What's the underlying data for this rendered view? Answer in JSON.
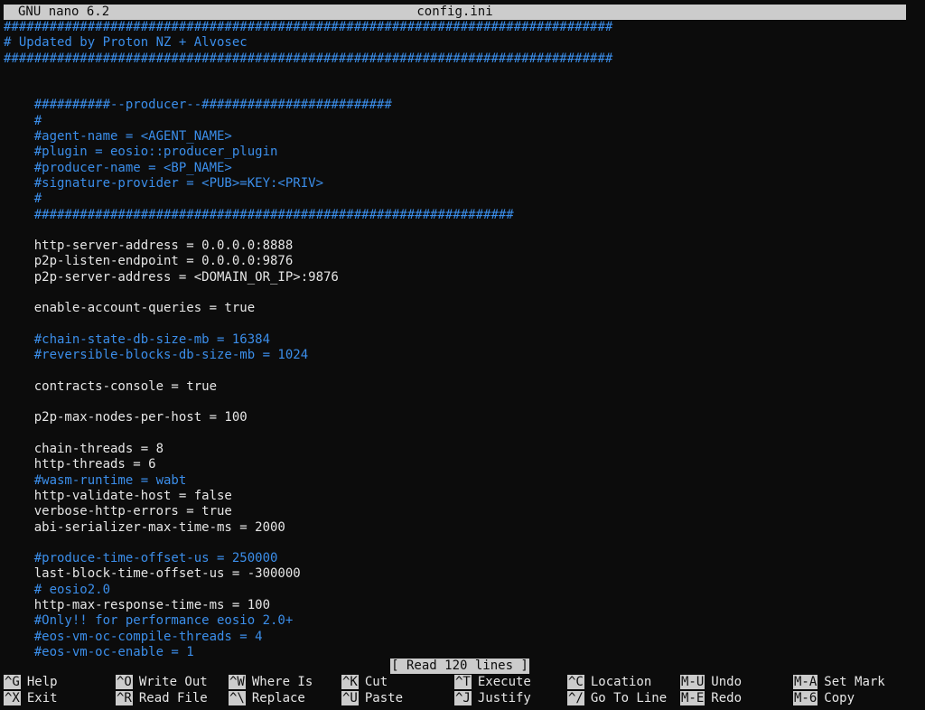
{
  "titlebar": {
    "app": "GNU nano 6.2",
    "filename": "config.ini"
  },
  "colors": {
    "comment": "#3b8eea",
    "text": "#e6e6e6",
    "background": "#0c0c0c",
    "bar": "#cccccc"
  },
  "lines": [
    {
      "text": "################################################################################",
      "type": "comment"
    },
    {
      "text": "# Updated by Proton NZ + Alvosec",
      "type": "comment"
    },
    {
      "text": "################################################################################",
      "type": "comment"
    },
    {
      "text": "",
      "type": "text"
    },
    {
      "text": "",
      "type": "text"
    },
    {
      "text": "    ##########--producer--#########################",
      "type": "comment"
    },
    {
      "text": "    #",
      "type": "comment"
    },
    {
      "text": "    #agent-name = <AGENT_NAME>",
      "type": "comment"
    },
    {
      "text": "    #plugin = eosio::producer_plugin",
      "type": "comment"
    },
    {
      "text": "    #producer-name = <BP_NAME>",
      "type": "comment"
    },
    {
      "text": "    #signature-provider = <PUB>=KEY:<PRIV>",
      "type": "comment"
    },
    {
      "text": "    #",
      "type": "comment"
    },
    {
      "text": "    ###############################################################",
      "type": "comment"
    },
    {
      "text": "",
      "type": "text"
    },
    {
      "text": "    http-server-address = 0.0.0.0:8888",
      "type": "text"
    },
    {
      "text": "    p2p-listen-endpoint = 0.0.0.0:9876",
      "type": "text"
    },
    {
      "text": "    p2p-server-address = <DOMAIN_OR_IP>:9876",
      "type": "text"
    },
    {
      "text": "",
      "type": "text"
    },
    {
      "text": "    enable-account-queries = true",
      "type": "text"
    },
    {
      "text": "",
      "type": "text"
    },
    {
      "text": "    #chain-state-db-size-mb = 16384",
      "type": "comment"
    },
    {
      "text": "    #reversible-blocks-db-size-mb = 1024",
      "type": "comment"
    },
    {
      "text": "",
      "type": "text"
    },
    {
      "text": "    contracts-console = true",
      "type": "text"
    },
    {
      "text": "",
      "type": "text"
    },
    {
      "text": "    p2p-max-nodes-per-host = 100",
      "type": "text"
    },
    {
      "text": "",
      "type": "text"
    },
    {
      "text": "    chain-threads = 8",
      "type": "text"
    },
    {
      "text": "    http-threads = 6",
      "type": "text"
    },
    {
      "text": "    #wasm-runtime = wabt",
      "type": "comment"
    },
    {
      "text": "    http-validate-host = false",
      "type": "text"
    },
    {
      "text": "    verbose-http-errors = true",
      "type": "text"
    },
    {
      "text": "    abi-serializer-max-time-ms = 2000",
      "type": "text"
    },
    {
      "text": "",
      "type": "text"
    },
    {
      "text": "    #produce-time-offset-us = 250000",
      "type": "comment"
    },
    {
      "text": "    last-block-time-offset-us = -300000",
      "type": "text"
    },
    {
      "text": "    # eosio2.0",
      "type": "comment"
    },
    {
      "text": "    http-max-response-time-ms = 100",
      "type": "text"
    },
    {
      "text": "    #Only!! for performance eosio 2.0+",
      "type": "comment"
    },
    {
      "text": "    #eos-vm-oc-compile-threads = 4",
      "type": "comment"
    },
    {
      "text": "    #eos-vm-oc-enable = 1",
      "type": "comment"
    }
  ],
  "status": "[ Read 120 lines ]",
  "shortcuts": [
    [
      {
        "key": "^G",
        "label": "Help"
      },
      {
        "key": "^O",
        "label": "Write Out"
      },
      {
        "key": "^W",
        "label": "Where Is"
      },
      {
        "key": "^K",
        "label": "Cut"
      },
      {
        "key": "^T",
        "label": "Execute"
      },
      {
        "key": "^C",
        "label": "Location"
      },
      {
        "key": "M-U",
        "label": "Undo"
      },
      {
        "key": "M-A",
        "label": "Set Mark"
      }
    ],
    [
      {
        "key": "^X",
        "label": "Exit"
      },
      {
        "key": "^R",
        "label": "Read File"
      },
      {
        "key": "^\\",
        "label": "Replace"
      },
      {
        "key": "^U",
        "label": "Paste"
      },
      {
        "key": "^J",
        "label": "Justify"
      },
      {
        "key": "^/",
        "label": "Go To Line"
      },
      {
        "key": "M-E",
        "label": "Redo"
      },
      {
        "key": "M-6",
        "label": "Copy"
      }
    ]
  ]
}
